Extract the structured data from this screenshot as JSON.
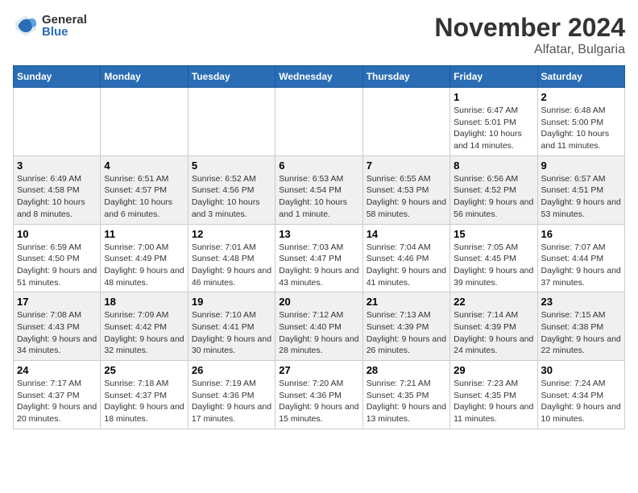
{
  "header": {
    "logo_general": "General",
    "logo_blue": "Blue",
    "month": "November 2024",
    "location": "Alfatar, Bulgaria"
  },
  "weekdays": [
    "Sunday",
    "Monday",
    "Tuesday",
    "Wednesday",
    "Thursday",
    "Friday",
    "Saturday"
  ],
  "weeks": [
    {
      "shade": false,
      "days": [
        null,
        null,
        null,
        null,
        null,
        {
          "num": "1",
          "sunrise": "Sunrise: 6:47 AM",
          "sunset": "Sunset: 5:01 PM",
          "daylight": "Daylight: 10 hours and 14 minutes."
        },
        {
          "num": "2",
          "sunrise": "Sunrise: 6:48 AM",
          "sunset": "Sunset: 5:00 PM",
          "daylight": "Daylight: 10 hours and 11 minutes."
        }
      ]
    },
    {
      "shade": true,
      "days": [
        {
          "num": "3",
          "sunrise": "Sunrise: 6:49 AM",
          "sunset": "Sunset: 4:58 PM",
          "daylight": "Daylight: 10 hours and 8 minutes."
        },
        {
          "num": "4",
          "sunrise": "Sunrise: 6:51 AM",
          "sunset": "Sunset: 4:57 PM",
          "daylight": "Daylight: 10 hours and 6 minutes."
        },
        {
          "num": "5",
          "sunrise": "Sunrise: 6:52 AM",
          "sunset": "Sunset: 4:56 PM",
          "daylight": "Daylight: 10 hours and 3 minutes."
        },
        {
          "num": "6",
          "sunrise": "Sunrise: 6:53 AM",
          "sunset": "Sunset: 4:54 PM",
          "daylight": "Daylight: 10 hours and 1 minute."
        },
        {
          "num": "7",
          "sunrise": "Sunrise: 6:55 AM",
          "sunset": "Sunset: 4:53 PM",
          "daylight": "Daylight: 9 hours and 58 minutes."
        },
        {
          "num": "8",
          "sunrise": "Sunrise: 6:56 AM",
          "sunset": "Sunset: 4:52 PM",
          "daylight": "Daylight: 9 hours and 56 minutes."
        },
        {
          "num": "9",
          "sunrise": "Sunrise: 6:57 AM",
          "sunset": "Sunset: 4:51 PM",
          "daylight": "Daylight: 9 hours and 53 minutes."
        }
      ]
    },
    {
      "shade": false,
      "days": [
        {
          "num": "10",
          "sunrise": "Sunrise: 6:59 AM",
          "sunset": "Sunset: 4:50 PM",
          "daylight": "Daylight: 9 hours and 51 minutes."
        },
        {
          "num": "11",
          "sunrise": "Sunrise: 7:00 AM",
          "sunset": "Sunset: 4:49 PM",
          "daylight": "Daylight: 9 hours and 48 minutes."
        },
        {
          "num": "12",
          "sunrise": "Sunrise: 7:01 AM",
          "sunset": "Sunset: 4:48 PM",
          "daylight": "Daylight: 9 hours and 46 minutes."
        },
        {
          "num": "13",
          "sunrise": "Sunrise: 7:03 AM",
          "sunset": "Sunset: 4:47 PM",
          "daylight": "Daylight: 9 hours and 43 minutes."
        },
        {
          "num": "14",
          "sunrise": "Sunrise: 7:04 AM",
          "sunset": "Sunset: 4:46 PM",
          "daylight": "Daylight: 9 hours and 41 minutes."
        },
        {
          "num": "15",
          "sunrise": "Sunrise: 7:05 AM",
          "sunset": "Sunset: 4:45 PM",
          "daylight": "Daylight: 9 hours and 39 minutes."
        },
        {
          "num": "16",
          "sunrise": "Sunrise: 7:07 AM",
          "sunset": "Sunset: 4:44 PM",
          "daylight": "Daylight: 9 hours and 37 minutes."
        }
      ]
    },
    {
      "shade": true,
      "days": [
        {
          "num": "17",
          "sunrise": "Sunrise: 7:08 AM",
          "sunset": "Sunset: 4:43 PM",
          "daylight": "Daylight: 9 hours and 34 minutes."
        },
        {
          "num": "18",
          "sunrise": "Sunrise: 7:09 AM",
          "sunset": "Sunset: 4:42 PM",
          "daylight": "Daylight: 9 hours and 32 minutes."
        },
        {
          "num": "19",
          "sunrise": "Sunrise: 7:10 AM",
          "sunset": "Sunset: 4:41 PM",
          "daylight": "Daylight: 9 hours and 30 minutes."
        },
        {
          "num": "20",
          "sunrise": "Sunrise: 7:12 AM",
          "sunset": "Sunset: 4:40 PM",
          "daylight": "Daylight: 9 hours and 28 minutes."
        },
        {
          "num": "21",
          "sunrise": "Sunrise: 7:13 AM",
          "sunset": "Sunset: 4:39 PM",
          "daylight": "Daylight: 9 hours and 26 minutes."
        },
        {
          "num": "22",
          "sunrise": "Sunrise: 7:14 AM",
          "sunset": "Sunset: 4:39 PM",
          "daylight": "Daylight: 9 hours and 24 minutes."
        },
        {
          "num": "23",
          "sunrise": "Sunrise: 7:15 AM",
          "sunset": "Sunset: 4:38 PM",
          "daylight": "Daylight: 9 hours and 22 minutes."
        }
      ]
    },
    {
      "shade": false,
      "days": [
        {
          "num": "24",
          "sunrise": "Sunrise: 7:17 AM",
          "sunset": "Sunset: 4:37 PM",
          "daylight": "Daylight: 9 hours and 20 minutes."
        },
        {
          "num": "25",
          "sunrise": "Sunrise: 7:18 AM",
          "sunset": "Sunset: 4:37 PM",
          "daylight": "Daylight: 9 hours and 18 minutes."
        },
        {
          "num": "26",
          "sunrise": "Sunrise: 7:19 AM",
          "sunset": "Sunset: 4:36 PM",
          "daylight": "Daylight: 9 hours and 17 minutes."
        },
        {
          "num": "27",
          "sunrise": "Sunrise: 7:20 AM",
          "sunset": "Sunset: 4:36 PM",
          "daylight": "Daylight: 9 hours and 15 minutes."
        },
        {
          "num": "28",
          "sunrise": "Sunrise: 7:21 AM",
          "sunset": "Sunset: 4:35 PM",
          "daylight": "Daylight: 9 hours and 13 minutes."
        },
        {
          "num": "29",
          "sunrise": "Sunrise: 7:23 AM",
          "sunset": "Sunset: 4:35 PM",
          "daylight": "Daylight: 9 hours and 11 minutes."
        },
        {
          "num": "30",
          "sunrise": "Sunrise: 7:24 AM",
          "sunset": "Sunset: 4:34 PM",
          "daylight": "Daylight: 9 hours and 10 minutes."
        }
      ]
    }
  ]
}
